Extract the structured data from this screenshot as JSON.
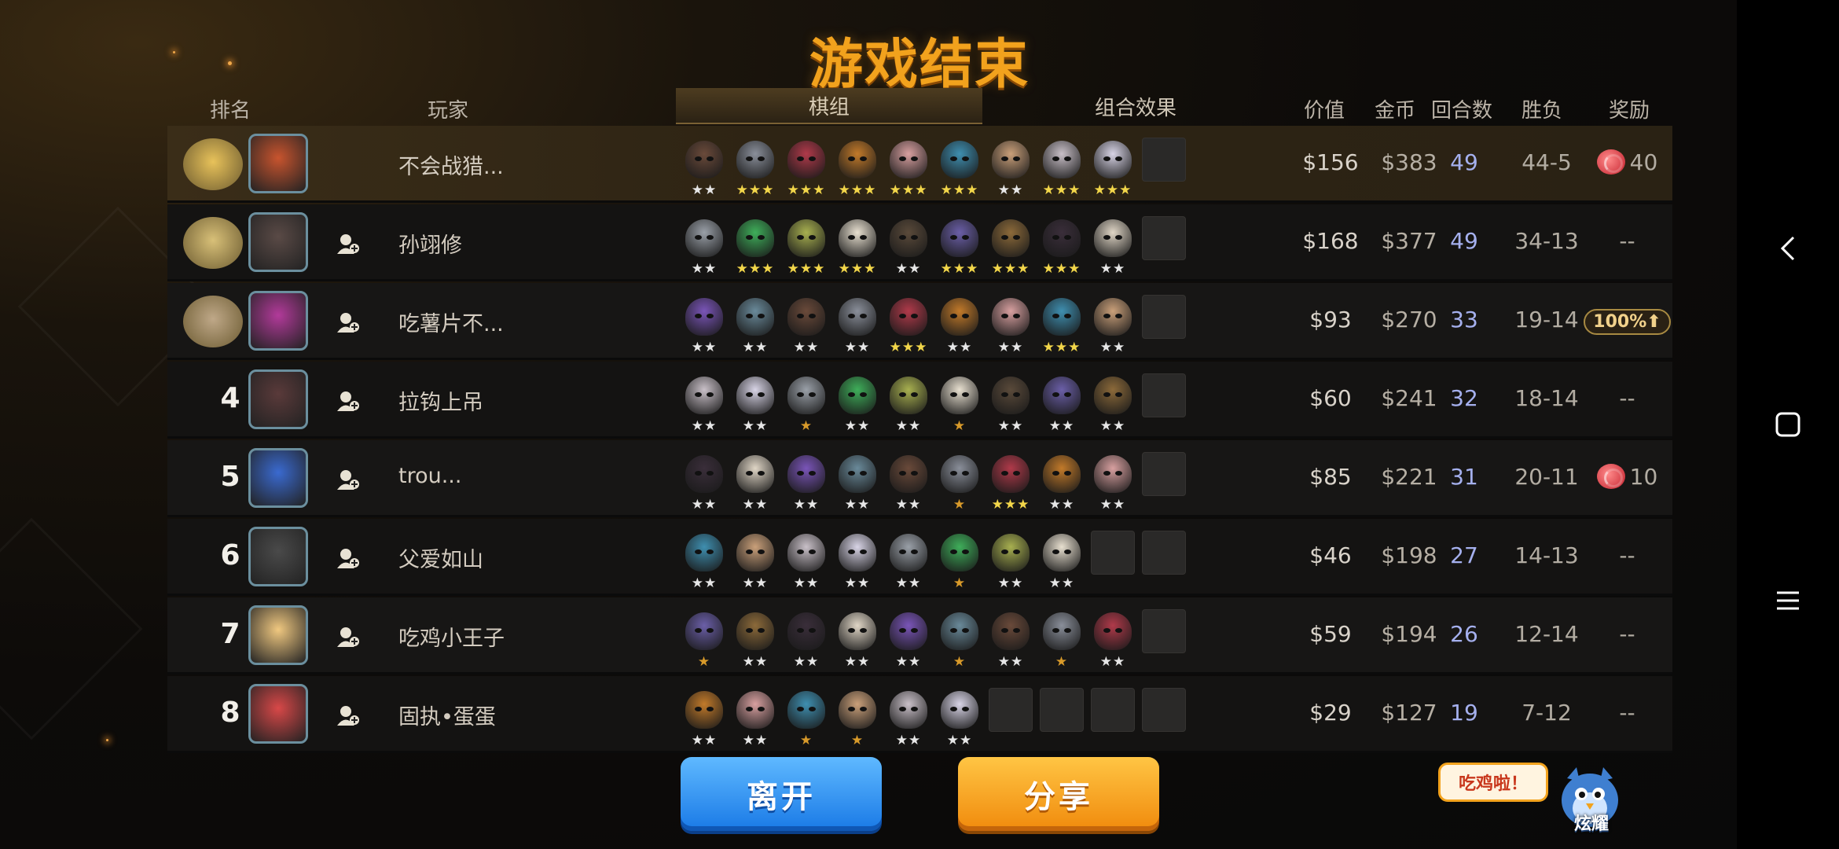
{
  "title": "游戏结束",
  "headers": {
    "rank": "排名",
    "player": "玩家",
    "tab_pieces": "棋组",
    "tab_combo": "组合效果",
    "value": "价值",
    "gold": "金币",
    "rounds": "回合数",
    "win_loss": "胜负",
    "reward": "奖励"
  },
  "rows": [
    {
      "rank": "1",
      "rank_badge": "gold-crown",
      "name": "不会战猎...",
      "value": "$156",
      "gold": "$383",
      "rounds": "49",
      "win_loss": "44-5",
      "reward": {
        "type": "candy",
        "text": "40"
      },
      "stars": [
        "★★",
        "★★★",
        "★★★",
        "★★★",
        "★★★",
        "★★★",
        "★★",
        "★★★",
        "★★★"
      ],
      "star_gold": [
        false,
        false,
        false,
        false,
        false,
        false,
        false,
        false,
        false
      ]
    },
    {
      "rank": "2",
      "rank_badge": "silver-laurel",
      "name": "孙翊修",
      "value": "$168",
      "gold": "$377",
      "rounds": "49",
      "win_loss": "34-13",
      "reward": {
        "type": "none",
        "text": "--"
      },
      "stars": [
        "★★",
        "★★★",
        "★★★",
        "★★★",
        "★★",
        "★★★",
        "★★★",
        "★★★",
        "★★"
      ],
      "star_gold": [
        false,
        false,
        false,
        false,
        false,
        false,
        false,
        false,
        false
      ]
    },
    {
      "rank": "3",
      "rank_badge": "bronze-laurel",
      "name": "吃薯片不...",
      "value": "$93",
      "gold": "$270",
      "rounds": "33",
      "win_loss": "19-14",
      "reward": {
        "type": "badge",
        "text": "100%⬆"
      },
      "stars": [
        "★★",
        "★★",
        "★★",
        "★★",
        "★★★",
        "★★",
        "★★",
        "★★★",
        "★★"
      ],
      "star_gold": [
        false,
        false,
        false,
        false,
        false,
        false,
        false,
        false,
        false
      ]
    },
    {
      "rank": "4",
      "rank_badge": "none",
      "name": "拉钩上吊",
      "value": "$60",
      "gold": "$241",
      "rounds": "32",
      "win_loss": "18-14",
      "reward": {
        "type": "none",
        "text": "--"
      },
      "stars": [
        "★★",
        "★★",
        "★",
        "★★",
        "★★",
        "★",
        "★★",
        "★★",
        "★★"
      ],
      "star_gold": [
        false,
        false,
        true,
        false,
        false,
        true,
        false,
        false,
        false
      ]
    },
    {
      "rank": "5",
      "rank_badge": "none",
      "name": "trou...",
      "value": "$85",
      "gold": "$221",
      "rounds": "31",
      "win_loss": "20-11",
      "reward": {
        "type": "candy",
        "text": "10"
      },
      "stars": [
        "★★",
        "★★",
        "★★",
        "★★",
        "★★",
        "★",
        "★★★",
        "★★",
        "★★"
      ],
      "star_gold": [
        false,
        false,
        false,
        false,
        false,
        true,
        false,
        false,
        false
      ]
    },
    {
      "rank": "6",
      "rank_badge": "none",
      "name": "父爱如山",
      "value": "$46",
      "gold": "$198",
      "rounds": "27",
      "win_loss": "14-13",
      "reward": {
        "type": "none",
        "text": "--"
      },
      "stars": [
        "★★",
        "★★",
        "★★",
        "★★",
        "★★",
        "★",
        "★★",
        "★★"
      ],
      "star_gold": [
        false,
        false,
        false,
        false,
        false,
        true,
        false,
        false
      ]
    },
    {
      "rank": "7",
      "rank_badge": "none",
      "name": "吃鸡小王子",
      "value": "$59",
      "gold": "$194",
      "rounds": "26",
      "win_loss": "12-14",
      "reward": {
        "type": "none",
        "text": "--"
      },
      "stars": [
        "★",
        "★★",
        "★★",
        "★★",
        "★★",
        "★",
        "★★",
        "★",
        "★★"
      ],
      "star_gold": [
        true,
        false,
        false,
        false,
        false,
        true,
        false,
        true,
        false
      ]
    },
    {
      "rank": "8",
      "rank_badge": "none",
      "name": "固执•蛋蛋",
      "value": "$29",
      "gold": "$127",
      "rounds": "19",
      "win_loss": "7-12",
      "reward": {
        "type": "none",
        "text": "--"
      },
      "stars": [
        "★★",
        "★★",
        "★",
        "★",
        "★★",
        "★★"
      ],
      "star_gold": [
        false,
        false,
        true,
        true,
        false,
        false
      ]
    }
  ],
  "buttons": {
    "leave": "离开",
    "share": "分享"
  },
  "bubble": "吃鸡啦！",
  "mascot_label": "炫耀",
  "colors": {
    "title": "#f2a21d",
    "rounds_text": "#a5b0ee",
    "leave_button": "#1979e6",
    "share_button": "#f08a0c"
  },
  "icons": {
    "add_friend": "add-friend-icon",
    "candy": "candy-icon",
    "nav_back": "back-chevron-icon",
    "nav_home": "square-icon",
    "nav_menu": "hamburger-icon"
  }
}
